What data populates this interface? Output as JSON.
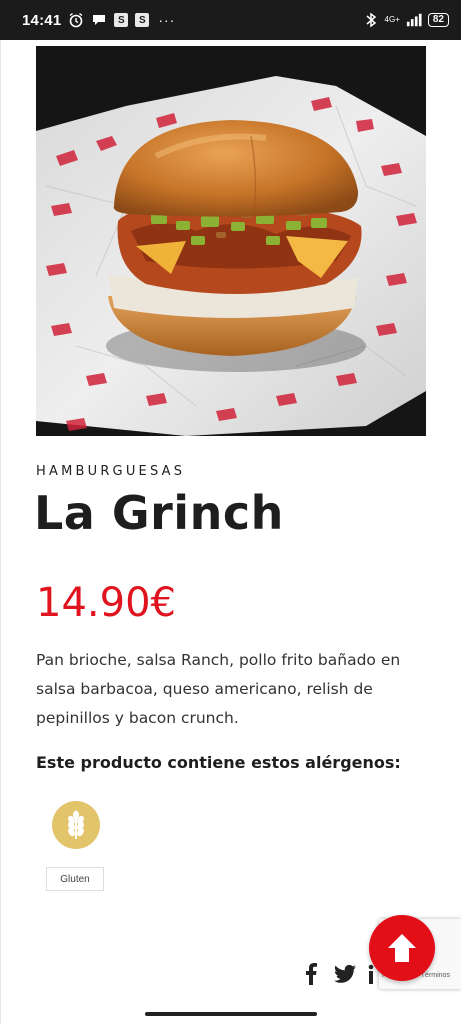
{
  "status_bar": {
    "time": "14:41",
    "icons_left": [
      "alarm-icon",
      "chat-bubble-icon"
    ],
    "notif_badges": [
      "S",
      "S"
    ],
    "more": "···",
    "network": "4G+",
    "battery": "82"
  },
  "product": {
    "category": "HAMBURGUESAS",
    "name": "La Grinch",
    "price": "14.90€",
    "description": "Pan brioche, salsa Ranch, pollo frito bañado en salsa barbacoa, queso americano, relish de pepinillos y bacon crunch.",
    "allergens_heading": "Este producto contiene estos alérgenos:",
    "allergens": [
      {
        "label": "Gluten",
        "icon": "wheat-icon",
        "color": "#e2c46a"
      }
    ]
  },
  "recaptcha": {
    "text": "Privacidad · Términos"
  },
  "social": [
    "facebook-icon",
    "twitter-icon",
    "linkedin-icon"
  ],
  "colors": {
    "accent": "#e0141e",
    "scroll_button": "#e20f19"
  }
}
